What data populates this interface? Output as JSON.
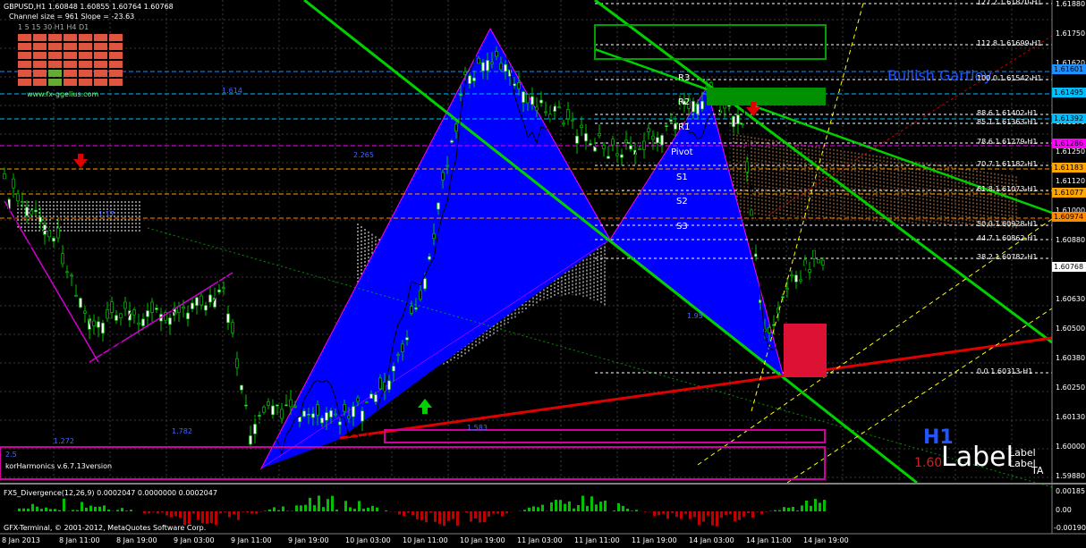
{
  "header": {
    "symbol_line": "GBPUSD,H1  1.60848 1.60855 1.60764 1.60768",
    "channel_line": "Channel size = 961 Slope = -23.63",
    "timeframes": "1  5  15  30  H1  H4  D1",
    "site": "www.fx-ggelius.com"
  },
  "pattern": {
    "label": "Bullish Gartley"
  },
  "version": {
    "label": "korHarmonics v.6.7.13version"
  },
  "pivots": [
    "R3",
    "R2",
    "R1",
    "Pivot",
    "S1",
    "S2",
    "S3"
  ],
  "fib_levels": [
    {
      "label": "127.2 1.61870-H1"
    },
    {
      "label": "112.8 1.61699-H1"
    },
    {
      "label": "100.0 1.61542-H1"
    },
    {
      "label": "88.6 1.61402-H1"
    },
    {
      "label": "85.1 1.61363-H1"
    },
    {
      "label": "78.6 1.61279-H1"
    },
    {
      "label": "70.7 1.61182-H1"
    },
    {
      "label": "61.8 1.61073-H1"
    },
    {
      "label": "50.0 1.60928-H1"
    },
    {
      "label": "44.7 1.60862-H1"
    },
    {
      "label": "38.2 1.60782-H1"
    },
    {
      "label": "0.0 1.60313-H1"
    }
  ],
  "price_axis": [
    "1.61880",
    "1.61750",
    "1.61620",
    "1.61490",
    "1.61370",
    "1.61250",
    "1.61120",
    "1.61000",
    "1.60880",
    "1.60750",
    "1.60630",
    "1.60500",
    "1.60380",
    "1.60250",
    "1.60130",
    "1.60000",
    "1.59880"
  ],
  "price_boxes": [
    {
      "label": "1.61601",
      "color": "#1e90ff"
    },
    {
      "label": "1.61495",
      "color": "#00bfff"
    },
    {
      "label": "1.61392",
      "color": "#00bfff"
    },
    {
      "label": "1.61286",
      "color": "#ff00ff"
    },
    {
      "label": "1.61183",
      "color": "#ffa500"
    },
    {
      "label": "1.61077",
      "color": "#ffa500"
    },
    {
      "label": "1.60974",
      "color": "#ff8c00"
    },
    {
      "label": "1.60768",
      "color": "#ffffff"
    }
  ],
  "mini_labels": {
    "a": "1.614",
    "b": "2.265",
    "c": "1.17",
    "d": "1.272",
    "e": "1.782",
    "f": "1.583",
    "g": "1.95",
    "h": "2.5"
  },
  "corner": {
    "h1": "H1",
    "big_label": "Label",
    "small_label": "Label",
    "small_label2": "Label",
    "price_small": "1.60",
    "ta": "TA"
  },
  "indicator": {
    "label": "FX5_Divergence(12,26,9) 0.0002047 0.0000000 0.0002047",
    "axis": [
      "0.00185",
      "0.00",
      "-0.00190"
    ]
  },
  "footer": {
    "copyright": "GFX-Terminal, © 2001-2012, MetaQuotes Software Corp."
  },
  "time_axis": [
    "8 Jan 2013",
    "8 Jan 11:00",
    "8 Jan 19:00",
    "9 Jan 03:00",
    "9 Jan 11:00",
    "9 Jan 19:00",
    "10 Jan 03:00",
    "10 Jan 11:00",
    "10 Jan 19:00",
    "11 Jan 03:00",
    "11 Jan 11:00",
    "11 Jan 19:00",
    "14 Jan 03:00",
    "14 Jan 11:00",
    "14 Jan 19:00"
  ],
  "colors": {
    "background": "#000000",
    "bull_candle": "#ffffff",
    "pattern_fill": "#0000ff",
    "trendline": "#00d000",
    "support": "#ff0000",
    "fib": "#ffffff"
  }
}
